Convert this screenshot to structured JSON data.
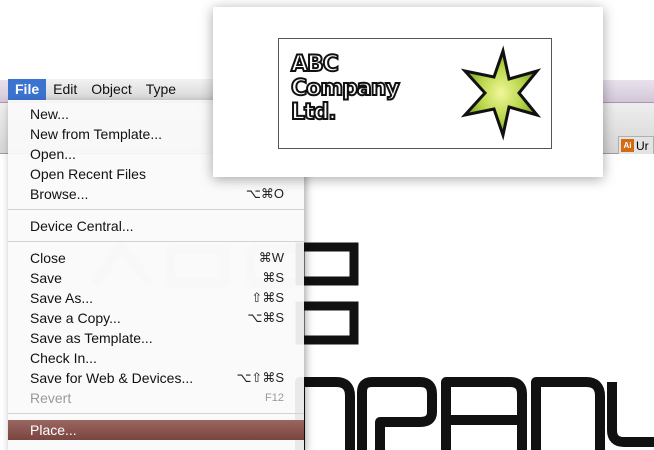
{
  "menubar": {
    "items": [
      "File",
      "Edit",
      "Object",
      "Type"
    ]
  },
  "doc_tab": {
    "icon_text": "Ai",
    "label": "Ur"
  },
  "file_menu": {
    "groups": [
      [
        {
          "label": "New...",
          "shortcut": ""
        },
        {
          "label": "New from Template...",
          "shortcut": ""
        },
        {
          "label": "Open...",
          "shortcut": ""
        },
        {
          "label": "Open Recent Files",
          "shortcut": ""
        },
        {
          "label": "Browse...",
          "shortcut": "⌥⌘O"
        }
      ],
      [
        {
          "label": "Device Central...",
          "shortcut": ""
        }
      ],
      [
        {
          "label": "Close",
          "shortcut": "⌘W"
        },
        {
          "label": "Save",
          "shortcut": "⌘S"
        },
        {
          "label": "Save As...",
          "shortcut": "⇧⌘S"
        },
        {
          "label": "Save a Copy...",
          "shortcut": "⌥⌘S"
        },
        {
          "label": "Save as Template...",
          "shortcut": ""
        },
        {
          "label": "Check In...",
          "shortcut": ""
        },
        {
          "label": "Save for Web & Devices...",
          "shortcut": "⌥⇧⌘S"
        },
        {
          "label": "Revert",
          "shortcut": "F12",
          "disabled": true
        }
      ],
      [
        {
          "label": "Place...",
          "shortcut": "",
          "highlighted": true
        }
      ]
    ]
  },
  "logo": {
    "lines": [
      "ABC",
      "Company",
      "Ltd."
    ],
    "star_colors": {
      "center": "#f2f79a",
      "mid": "#b8d64a",
      "edge": "#6f9a24",
      "outline": "#111111"
    }
  },
  "colors": {
    "menu_highlight": "#8a5550",
    "menubar_active": "#3b73d1"
  }
}
